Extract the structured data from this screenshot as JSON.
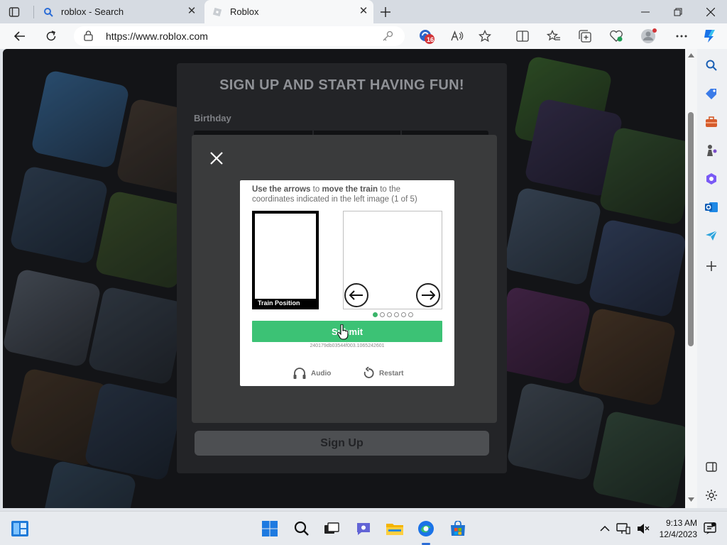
{
  "browser": {
    "tabs": [
      {
        "title": "roblox - Search",
        "icon": "search-favicon"
      },
      {
        "title": "Roblox",
        "icon": "roblox-favicon",
        "active": true
      }
    ],
    "url": "https://www.roblox.com",
    "notification_badge": "16"
  },
  "page": {
    "form_title": "SIGN UP AND START HAVING FUN!",
    "birthday_label": "Birthday",
    "signup_button": "Sign Up"
  },
  "captcha": {
    "instruction_parts": {
      "bold1": "Use the arrows",
      "text1": " to ",
      "bold2": "move the train",
      "text2": " to the coordinates indicated in the left image (1 of 5)"
    },
    "train_position_label": "Train Position",
    "submit_label": "Submit",
    "session_id": "240179db03544f003.1065242601",
    "audio_label": "Audio",
    "restart_label": "Restart",
    "progress": {
      "current": 1,
      "total": 6
    }
  },
  "taskbar": {
    "time": "9:13 AM",
    "date": "12/4/2023"
  },
  "colors": {
    "submit_green": "#3cc275",
    "page_background": "#1a1b1e",
    "overlay": "#3a3b3c"
  }
}
